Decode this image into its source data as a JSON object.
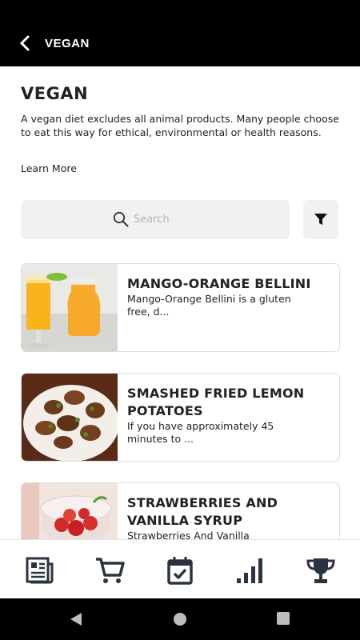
{
  "header": {
    "title": "VEGAN"
  },
  "main": {
    "title": "VEGAN",
    "description": "A vegan diet excludes all animal products. Many people choose to eat this way for ethical, environmental or health reasons.",
    "learn_more": "Learn More"
  },
  "search": {
    "placeholder": "Search"
  },
  "recipes": [
    {
      "title": "MANGO-ORANGE BELLINI",
      "subtitle": "Mango-Orange Bellini is a gluten free, d..."
    },
    {
      "title": "SMASHED FRIED LEMON POTATOES",
      "subtitle": "If you have approximately 45 minutes to ..."
    },
    {
      "title": "STRAWBERRIES AND VANILLA SYRUP",
      "subtitle": "Strawberries And Vanilla"
    }
  ],
  "bottom_nav": [
    {
      "icon": "newspaper-icon"
    },
    {
      "icon": "cart-icon"
    },
    {
      "icon": "calendar-check-icon"
    },
    {
      "icon": "bar-chart-icon"
    },
    {
      "icon": "trophy-icon"
    }
  ],
  "colors": {
    "topbar": "#000000",
    "text": "#222222",
    "search_bg": "#f1f1f1"
  }
}
